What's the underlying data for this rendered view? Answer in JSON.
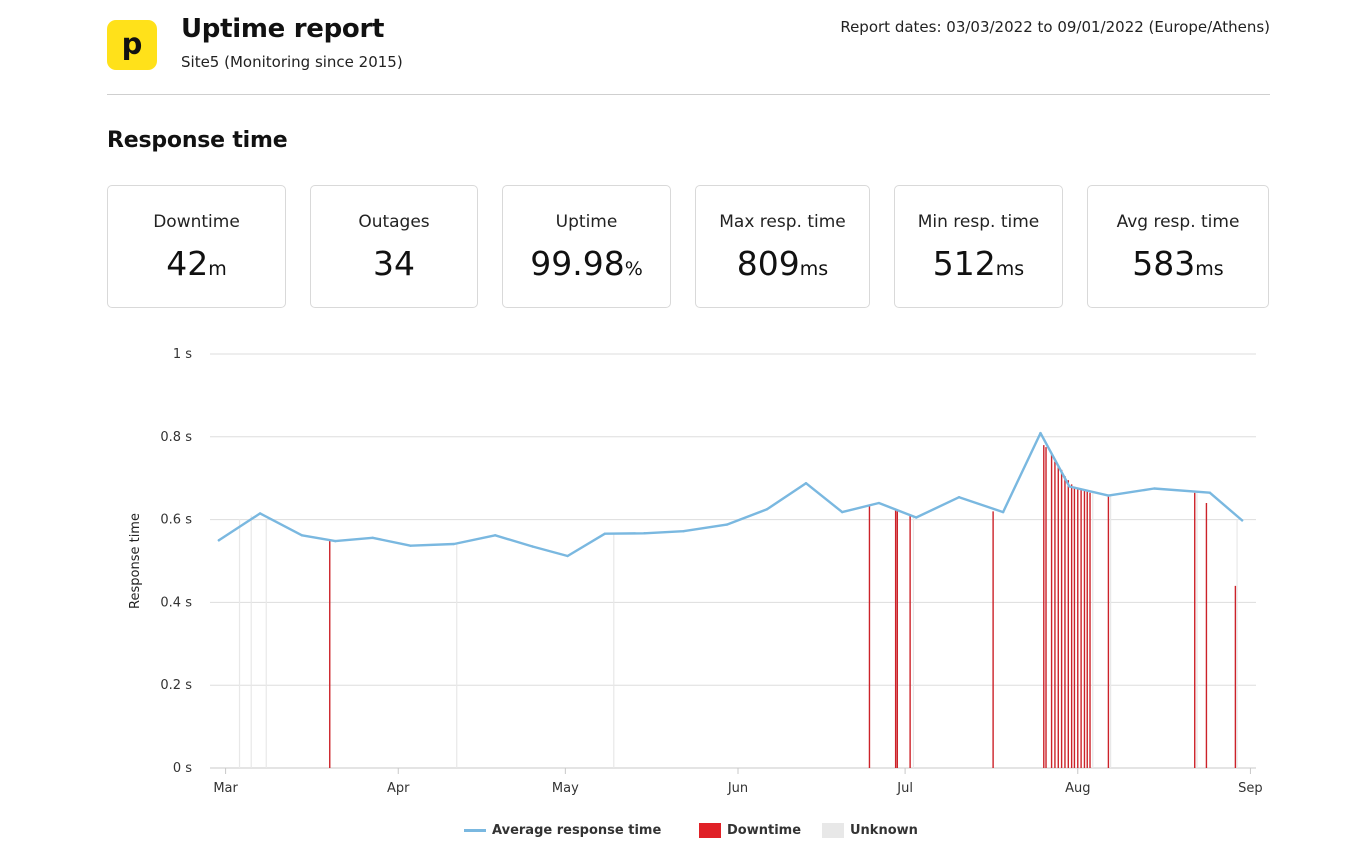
{
  "header": {
    "logo_letter": "p",
    "title": "Uptime report",
    "subtitle": "Site5 (Monitoring since 2015)",
    "report_dates": "Report dates: 03/03/2022 to 09/01/2022 (Europe/Athens)"
  },
  "section_title": "Response time",
  "stats": [
    {
      "label": "Downtime",
      "value": "42",
      "unit": "m"
    },
    {
      "label": "Outages",
      "value": "34",
      "unit": ""
    },
    {
      "label": "Uptime",
      "value": "99.98",
      "unit": "%"
    },
    {
      "label": "Max resp. time",
      "value": "809",
      "unit": "ms"
    },
    {
      "label": "Min resp. time",
      "value": "512",
      "unit": "ms"
    },
    {
      "label": "Avg resp. time",
      "value": "583",
      "unit": "ms"
    }
  ],
  "colors": {
    "logo_bg": "#ffe11a",
    "line": "#7ab8e0",
    "downtime": "#cc2229",
    "downtime_legend": "#e02127",
    "unknown": "#e8e8e8",
    "grid": "#dddddd"
  },
  "legend": {
    "average": "Average response time",
    "downtime": "Downtime",
    "unknown": "Unknown"
  },
  "chart_data": {
    "type": "line",
    "title": "",
    "ylabel": "Response time",
    "xlabel": "",
    "x_ticks": [
      "Mar",
      "Apr",
      "May",
      "Jun",
      "Jul",
      "Aug",
      "Sep"
    ],
    "x_tick_days": [
      0,
      31,
      61,
      92,
      122,
      153,
      184
    ],
    "y_ticks": [
      0,
      0.2,
      0.4,
      0.6,
      0.8,
      1.0
    ],
    "y_tick_labels": [
      "0 s",
      "0.2 s",
      "0.4 s",
      "0.6 s",
      "0.8 s",
      "1 s"
    ],
    "ylim": [
      0,
      1
    ],
    "xlim": [
      -2.8,
      185
    ],
    "grid": true,
    "legend_position": "bottom",
    "series": [
      {
        "name": "Average response time",
        "x": [
          -1.2,
          6.2,
          13.7,
          19.7,
          26.4,
          33.2,
          41.0,
          48.4,
          55.1,
          61.4,
          68.1,
          75.2,
          82.2,
          90.0,
          97.2,
          104.2,
          110.7,
          117.3,
          124.0,
          131.7,
          139.6,
          146.3,
          151.5,
          158.5,
          166.7,
          176.7,
          182.5
        ],
        "y": [
          0.55,
          0.615,
          0.562,
          0.548,
          0.556,
          0.537,
          0.541,
          0.562,
          0.535,
          0.512,
          0.566,
          0.567,
          0.572,
          0.588,
          0.625,
          0.688,
          0.618,
          0.64,
          0.605,
          0.654,
          0.618,
          0.809,
          0.68,
          0.658,
          0.675,
          0.665,
          0.598
        ]
      }
    ],
    "downtime_events": [
      {
        "x": 18.7,
        "y": 0.55
      },
      {
        "x": 115.6,
        "y": 0.635
      },
      {
        "x": 120.3,
        "y": 0.625
      },
      {
        "x": 120.6,
        "y": 0.62
      },
      {
        "x": 122.9,
        "y": 0.61
      },
      {
        "x": 137.8,
        "y": 0.62
      },
      {
        "x": 146.9,
        "y": 0.78
      },
      {
        "x": 147.3,
        "y": 0.775
      },
      {
        "x": 148.3,
        "y": 0.76
      },
      {
        "x": 148.9,
        "y": 0.74
      },
      {
        "x": 149.5,
        "y": 0.73
      },
      {
        "x": 150.1,
        "y": 0.72
      },
      {
        "x": 150.7,
        "y": 0.705
      },
      {
        "x": 151.3,
        "y": 0.695
      },
      {
        "x": 151.9,
        "y": 0.685
      },
      {
        "x": 152.4,
        "y": 0.68
      },
      {
        "x": 153.0,
        "y": 0.675
      },
      {
        "x": 153.6,
        "y": 0.672
      },
      {
        "x": 154.2,
        "y": 0.67
      },
      {
        "x": 154.7,
        "y": 0.668
      },
      {
        "x": 155.2,
        "y": 0.665
      },
      {
        "x": 158.5,
        "y": 0.658
      },
      {
        "x": 174.0,
        "y": 0.665
      },
      {
        "x": 176.1,
        "y": 0.64
      },
      {
        "x": 181.3,
        "y": 0.44
      }
    ],
    "unknown_periods": [
      {
        "x": 2.5,
        "y": 0.6
      },
      {
        "x": 4.6,
        "y": 0.61
      },
      {
        "x": 7.3,
        "y": 0.6
      },
      {
        "x": 41.5,
        "y": 0.54
      },
      {
        "x": 69.7,
        "y": 0.566
      },
      {
        "x": 123.5,
        "y": 0.61
      },
      {
        "x": 155.7,
        "y": 0.665
      },
      {
        "x": 158.9,
        "y": 0.658
      },
      {
        "x": 174.4,
        "y": 0.665
      },
      {
        "x": 181.6,
        "y": 0.6
      }
    ]
  }
}
